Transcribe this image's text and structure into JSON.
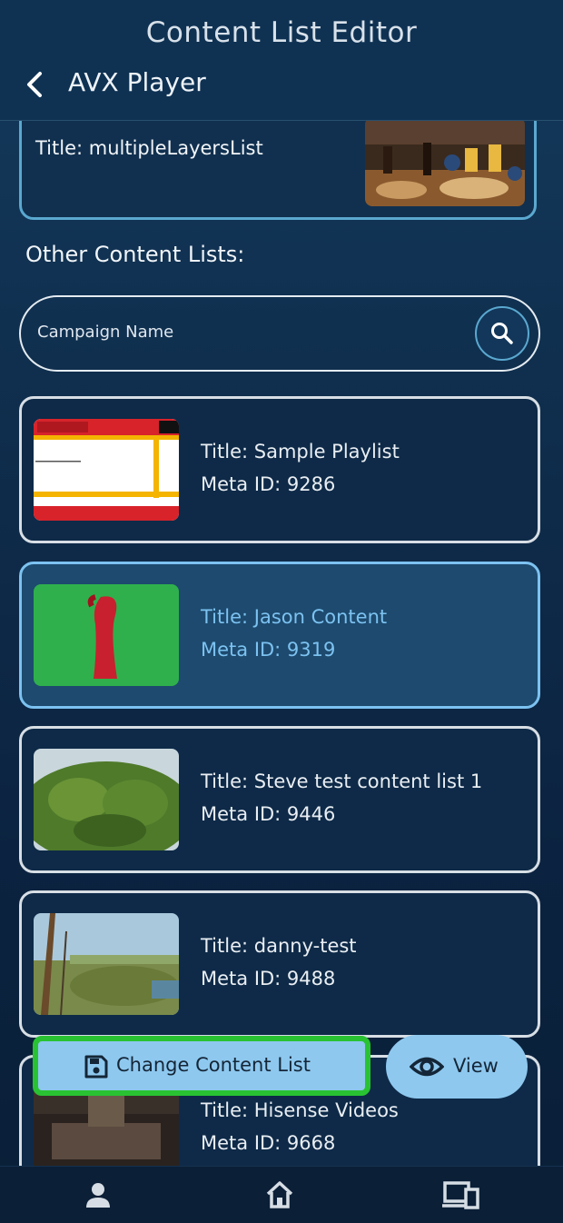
{
  "header": {
    "title": "Content List Editor",
    "subtitle": "AVX Player"
  },
  "current": {
    "title": "Title: multipleLayersList"
  },
  "section_label": "Other Content Lists:",
  "search": {
    "placeholder": "Campaign Name"
  },
  "items": [
    {
      "title": "Title: Sample Playlist",
      "meta": "Meta ID: 9286",
      "thumb": "news-thumbnail",
      "selected": false
    },
    {
      "title": "Title: Jason Content",
      "meta": "Meta ID: 9319",
      "thumb": "green-figure-thumbnail",
      "selected": true
    },
    {
      "title": "Title: Steve test content list 1",
      "meta": "Meta ID: 9446",
      "thumb": "tree-thumbnail",
      "selected": false
    },
    {
      "title": "Title: danny-test",
      "meta": "Meta ID: 9488",
      "thumb": "landscape-thumbnail",
      "selected": false
    },
    {
      "title": "Title: Hisense Videos",
      "meta": "Meta ID: 9668",
      "thumb": "bedroom-thumbnail",
      "selected": false
    }
  ],
  "actions": {
    "change_label": "Change Content List",
    "view_label": "View"
  },
  "colors": {
    "accent": "#7cc2f1",
    "highlight_border": "#29c232",
    "button_bg": "#8ec8ef"
  },
  "icons": [
    "back-arrow-icon",
    "search-icon",
    "save-icon",
    "eye-icon",
    "person-icon",
    "home-icon",
    "devices-icon"
  ]
}
